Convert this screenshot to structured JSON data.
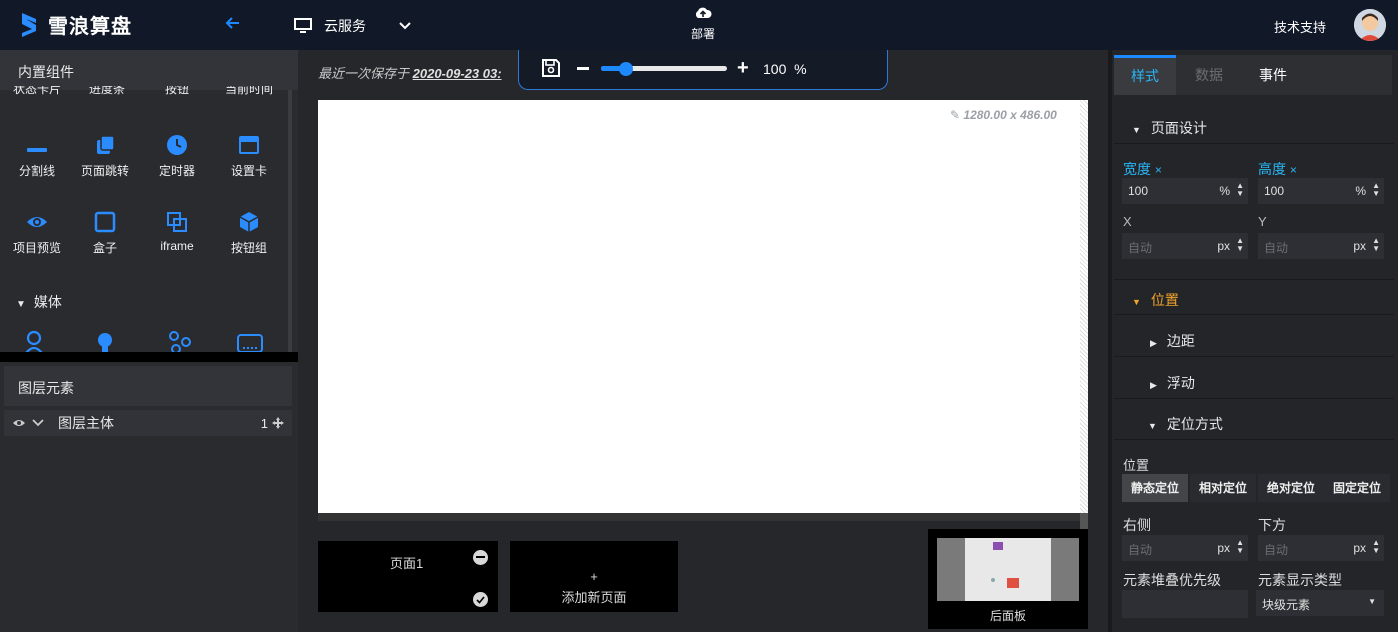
{
  "header": {
    "logo_text": "雪浪算盘",
    "service_label": "云服务",
    "deploy_label": "部署",
    "support_label": "技术支持"
  },
  "components": {
    "title": "内置组件",
    "row0": [
      "状态卡片",
      "进度条",
      "按钮",
      "当前时间"
    ],
    "row1": [
      "分割线",
      "页面跳转",
      "定时器",
      "设置卡"
    ],
    "row2": [
      "项目预览",
      "盒子",
      "iframe",
      "按钮组"
    ],
    "media_label": "媒体"
  },
  "layers": {
    "title": "图层元素",
    "row_label": "图层主体",
    "row_count": "1"
  },
  "editor": {
    "saved_prefix": "最近一次保存于",
    "saved_time": "2020-09-23 03:",
    "zoom_value": "100",
    "zoom_unit": "%",
    "zoom_fraction": 0.2,
    "canvas_size": "1280.00 x 486.00"
  },
  "pages": {
    "page1_label": "页面1",
    "add_plus": "+",
    "add_label": "添加新页面",
    "backpanel_label": "后面板"
  },
  "props": {
    "tabs": [
      "样式",
      "数据",
      "事件"
    ],
    "active_tab": "样式",
    "page_design": "页面设计",
    "width_label": "宽度",
    "height_label": "高度",
    "width_value": "100",
    "height_value": "100",
    "pct_unit": "%",
    "x_label": "X",
    "y_label": "Y",
    "auto_placeholder": "自动",
    "px_unit": "px",
    "position_section": "位置",
    "margin_label": "边距",
    "float_label": "浮动",
    "positioning_label": "定位方式",
    "position_field_label": "位置",
    "position_options": [
      "静态定位",
      "相对定位",
      "绝对定位",
      "固定定位"
    ],
    "right_label": "右侧",
    "bottom_label": "下方",
    "zindex_label": "元素堆叠优先级",
    "display_label": "元素显示类型",
    "display_value": "块级元素",
    "x_mark": "×"
  },
  "colors": {
    "accent": "#1e88ff",
    "cyan": "#29b6f6",
    "orange": "#f0a42a",
    "topbar": "#111828"
  }
}
